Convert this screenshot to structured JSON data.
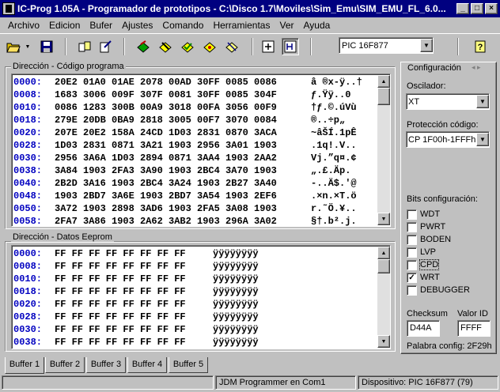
{
  "window": {
    "title": "IC-Prog 1.05A - Programador de prototipos - C:\\Disco 1.7\\Moviles\\Sim_Emu\\SIM_EMU_FL_6.0..."
  },
  "menu": [
    "Archivo",
    "Edicion",
    "Bufer",
    "Ajustes",
    "Comando",
    "Herramientas",
    "Ver",
    "Ayuda"
  ],
  "toolbar": {
    "device": "PIC 16F877",
    "icons": [
      "open-icon",
      "save-icon",
      "read-icon",
      "write-icon",
      "program-chip-icon",
      "erase-chip-icon",
      "verify-icon",
      "blank-check-icon",
      "config-icon",
      "view-icon",
      "view-hex-icon",
      "help-icon"
    ]
  },
  "program_memory": {
    "label": "Dirección - Código programa",
    "rows": [
      {
        "addr": "0000:",
        "words": "20E2 01A0 01AE 2078 00AD 30FF 0085 0086",
        "ascii": "â ®x-ÿ..†"
      },
      {
        "addr": "0008:",
        "words": "1683 3006 009F 307F 0081 30FF 0085 304F",
        "ascii": "ƒ.Ÿÿ..0"
      },
      {
        "addr": "0010:",
        "words": "0086 1283 300B 00A9 3018 00FA 3056 00F9",
        "ascii": "†ƒ.©.úVù"
      },
      {
        "addr": "0018:",
        "words": "279E 20DB 0BA9 2818 3005 00F7 3070 0084",
        "ascii": "®..÷p„"
      },
      {
        "addr": "0020:",
        "words": "207E 20E2 158A 24CD 1D03 2831 0870 3ACA",
        "ascii": "~âŠÍ.1pÊ"
      },
      {
        "addr": "0028:",
        "words": "1D03 2831 0871 3A21 1903 2956 3A01 1903",
        "ascii": ".1q!.V.."
      },
      {
        "addr": "0030:",
        "words": "2956 3A6A 1D03 2894 0871 3AA4 1903 2AA2",
        "ascii": "Vj.”q¤.¢"
      },
      {
        "addr": "0038:",
        "words": "3A84 1903 2FA3 3A90 1903 2BC4 3A70 1903",
        "ascii": "„.£.Äp."
      },
      {
        "addr": "0040:",
        "words": "2B2D 3A16 1903 2BC4 3A24 1903 2B27 3A40",
        "ascii": "-..Ä$.'@"
      },
      {
        "addr": "0048:",
        "words": "1903 2BD7 3A6E 1903 2BD7 3A54 1903 2EF6",
        "ascii": ".×n.×T.ö"
      },
      {
        "addr": "0050:",
        "words": "3A72 1903 2898 3AD6 1903 2FA5 3A08 1903",
        "ascii": "r.˜Ö.¥.."
      },
      {
        "addr": "0058:",
        "words": "2FA7 3A86 1903 2A62 3AB2 1903 296A 3A02",
        "ascii": "§†.b².j."
      }
    ]
  },
  "eeprom_memory": {
    "label": "Dirección - Datos Eeprom",
    "rows": [
      {
        "addr": "0000:",
        "words": "FF FF FF FF FF FF FF FF",
        "ascii": "ÿÿÿÿÿÿÿÿ"
      },
      {
        "addr": "0008:",
        "words": "FF FF FF FF FF FF FF FF",
        "ascii": "ÿÿÿÿÿÿÿÿ"
      },
      {
        "addr": "0010:",
        "words": "FF FF FF FF FF FF FF FF",
        "ascii": "ÿÿÿÿÿÿÿÿ"
      },
      {
        "addr": "0018:",
        "words": "FF FF FF FF FF FF FF FF",
        "ascii": "ÿÿÿÿÿÿÿÿ"
      },
      {
        "addr": "0020:",
        "words": "FF FF FF FF FF FF FF FF",
        "ascii": "ÿÿÿÿÿÿÿÿ"
      },
      {
        "addr": "0028:",
        "words": "FF FF FF FF FF FF FF FF",
        "ascii": "ÿÿÿÿÿÿÿÿ"
      },
      {
        "addr": "0030:",
        "words": "FF FF FF FF FF FF FF FF",
        "ascii": "ÿÿÿÿÿÿÿÿ"
      },
      {
        "addr": "0038:",
        "words": "FF FF FF FF FF FF FF FF",
        "ascii": "ÿÿÿÿÿÿÿÿ"
      }
    ]
  },
  "config": {
    "title": "Configuración",
    "oscillator_label": "Oscilador:",
    "oscillator_value": "XT",
    "protection_label": "Protección código:",
    "protection_value": "CP 1F00h-1FFFh",
    "bits_label": "Bits configuración:",
    "bits": [
      {
        "name": "WDT",
        "checked": false
      },
      {
        "name": "PWRT",
        "checked": false
      },
      {
        "name": "BODEN",
        "checked": false
      },
      {
        "name": "LVP",
        "checked": false
      },
      {
        "name": "CPD",
        "checked": false
      },
      {
        "name": "WRT",
        "checked": true
      },
      {
        "name": "DEBUGGER",
        "checked": false
      }
    ],
    "checksum_label": "Checksum",
    "checksum_value": "D44A",
    "id_label": "Valor ID",
    "id_value": "FFFF",
    "config_word": "Palabra config: 2F29h"
  },
  "tabs": [
    "Buffer 1",
    "Buffer 2",
    "Buffer 3",
    "Buffer 4",
    "Buffer 5"
  ],
  "status": {
    "left": "",
    "programmer": "JDM Programmer en Com1",
    "device": "Dispositivo: PIC 16F877  (79)"
  }
}
